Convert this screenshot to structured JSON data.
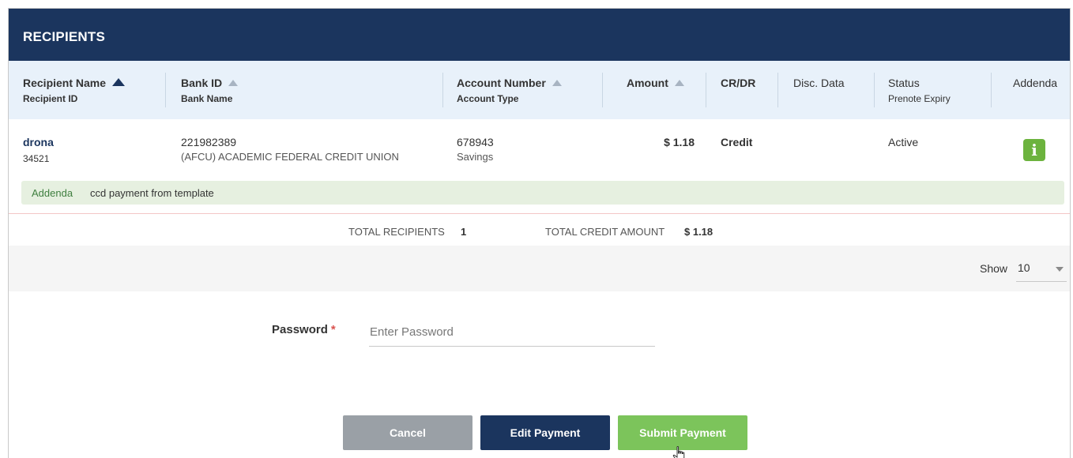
{
  "header": {
    "title": "RECIPIENTS"
  },
  "columns": [
    {
      "label": "Recipient Name",
      "sublabel": "Recipient ID"
    },
    {
      "label": "Bank ID",
      "sublabel": "Bank Name"
    },
    {
      "label": "Account Number",
      "sublabel": "Account Type"
    },
    {
      "label": "Amount",
      "sublabel": ""
    },
    {
      "label": "CR/DR",
      "sublabel": ""
    },
    {
      "label": "Disc. Data",
      "sublabel": ""
    },
    {
      "label": "Status",
      "sublabel": "Prenote Expiry"
    },
    {
      "label": "Addenda",
      "sublabel": ""
    }
  ],
  "recipient": {
    "name": "drona",
    "id": "34521",
    "bank_id": "221982389",
    "bank_name": "(AFCU) ACADEMIC FEDERAL CREDIT UNION",
    "account_number": "678943",
    "account_type": "Savings",
    "amount": "$ 1.18",
    "cr_dr": "Credit",
    "disc_data": "",
    "status": "Active",
    "info_glyph": "i"
  },
  "addenda": {
    "label": "Addenda",
    "value": "ccd payment from template"
  },
  "totals": {
    "recipients_label": "TOTAL RECIPIENTS",
    "recipients_value": "1",
    "credit_label": "TOTAL CREDIT AMOUNT",
    "credit_value": "$ 1.18"
  },
  "pagination": {
    "show_label": "Show",
    "show_value": "10"
  },
  "password": {
    "label": "Password",
    "required_mark": "*",
    "placeholder": "Enter Password"
  },
  "buttons": {
    "cancel": "Cancel",
    "edit": "Edit Payment",
    "submit": "Submit Payment"
  },
  "colors": {
    "navy": "#1b355e",
    "green": "#7cc45b",
    "gray": "#9aa0a6",
    "header_bg": "#e8f1fa"
  },
  "icons": {
    "sort": "sort-asc-icon",
    "info": "info-icon",
    "caret": "chevron-down-icon",
    "cursor": "hand-pointer-icon"
  }
}
